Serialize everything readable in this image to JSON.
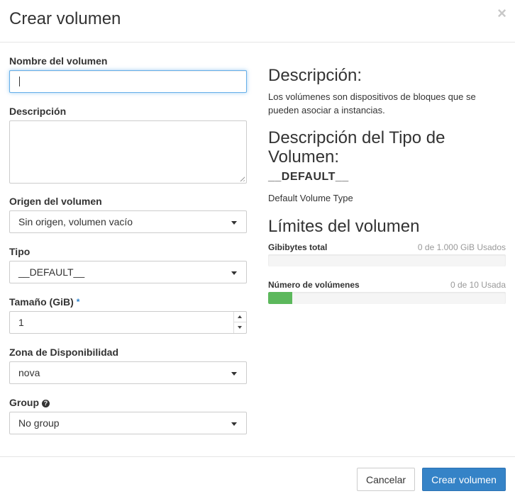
{
  "modal": {
    "title": "Crear volumen",
    "close_glyph": "×"
  },
  "form": {
    "name": {
      "label": "Nombre del volumen",
      "value": ""
    },
    "description": {
      "label": "Descripción",
      "value": ""
    },
    "source": {
      "label": "Origen del volumen",
      "selected": "Sin origen, volumen vacío"
    },
    "type": {
      "label": "Tipo",
      "selected": "__DEFAULT__"
    },
    "size": {
      "label": "Tamaño (GiB)",
      "required_mark": "*",
      "value": "1"
    },
    "availability_zone": {
      "label": "Zona de Disponibilidad",
      "selected": "nova"
    },
    "group": {
      "label": "Group",
      "help_glyph": "?",
      "selected": "No group"
    }
  },
  "info": {
    "description_heading": "Descripción:",
    "description_text": "Los volúmenes son dispositivos de bloques que se pueden asociar a instancias.",
    "type_heading": "Descripción del Tipo de Volumen:",
    "type_name": "__DEFAULT__",
    "type_description": "Default Volume Type",
    "limits_heading": "Límites del volumen",
    "quotas": [
      {
        "label": "Gibibytes total",
        "value_text": "0 de 1.000 GiB Usados",
        "fraction": 0.0,
        "color": "#5cb85c"
      },
      {
        "label": "Número de volúmenes",
        "value_text": "0 de 10 Usada",
        "fraction": 0.1,
        "color": "#5cb85c"
      }
    ]
  },
  "footer": {
    "cancel_label": "Cancelar",
    "submit_label": "Crear volumen"
  },
  "colors": {
    "primary": "#3583c7",
    "focus": "#66afe9",
    "progress_fill": "#5cb85c"
  },
  "icons": {
    "close": "close-icon",
    "help": "help-icon",
    "dropdown": "chevron-down-icon",
    "spin_up": "arrow-up-icon",
    "spin_down": "arrow-down-icon"
  }
}
